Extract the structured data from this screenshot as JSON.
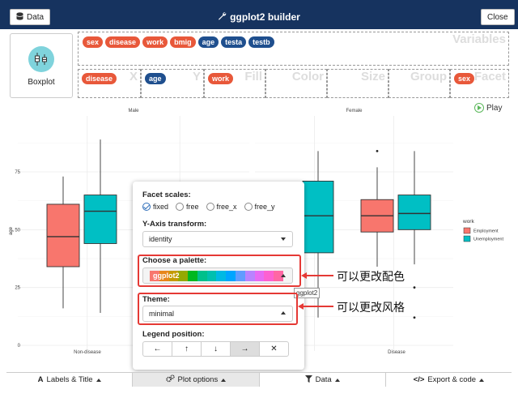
{
  "header": {
    "data_button": "Data",
    "title": "ggplot2 builder",
    "close_button": "Close",
    "bg_color": "#16335f"
  },
  "geom": {
    "label": "Boxplot",
    "icon": "boxplot-icon"
  },
  "dropzones": {
    "variables": {
      "label": "Variables",
      "chips": [
        {
          "label": "sex",
          "type": "categorical"
        },
        {
          "label": "disease",
          "type": "categorical"
        },
        {
          "label": "work",
          "type": "categorical"
        },
        {
          "label": "bmig",
          "type": "categorical"
        },
        {
          "label": "age",
          "type": "numeric"
        },
        {
          "label": "testa",
          "type": "numeric"
        },
        {
          "label": "testb",
          "type": "numeric"
        }
      ]
    },
    "x": {
      "label": "X",
      "chip": "disease"
    },
    "y": {
      "label": "Y",
      "chip": "age"
    },
    "fill": {
      "label": "Fill",
      "chip": "work"
    },
    "color": {
      "label": "Color"
    },
    "size": {
      "label": "Size"
    },
    "group": {
      "label": "Group"
    },
    "facet": {
      "label": "Facet",
      "chip": "sex"
    }
  },
  "play": {
    "label": "Play"
  },
  "chart_data": {
    "type": "bar",
    "subtype": "boxplot",
    "facets": [
      "Male",
      "Female"
    ],
    "ylabel": "age",
    "ylim": [
      0,
      100
    ],
    "yticks": [
      0,
      25,
      50,
      75
    ],
    "grid": true,
    "legend": {
      "title": "work",
      "position": "right",
      "entries": [
        {
          "name": "Employment",
          "color": "#f8766d"
        },
        {
          "name": "Unemployment",
          "color": "#00bfc4"
        }
      ]
    },
    "x_tick_labels": [
      "Non-disease",
      "Disease"
    ],
    "series": [
      {
        "name": "Male / Non-disease / Employment",
        "min": 16,
        "q1": 34,
        "median": 47,
        "q3": 61,
        "max": 73,
        "color": "#f8766d"
      },
      {
        "name": "Male / Non-disease / Unemployment",
        "min": 14,
        "q1": 44,
        "median": 58,
        "q3": 65,
        "max": 89,
        "color": "#00bfc4"
      },
      {
        "name": "Female / Non-disease / Unemployment",
        "min": 12,
        "q1": 40,
        "median": 56,
        "q3": 71,
        "max": 84,
        "color": "#00bfc4"
      },
      {
        "name": "Female / Disease / Employment",
        "min": 34,
        "q1": 49,
        "median": 56,
        "q3": 63,
        "max": 77,
        "outliers": [
          84
        ],
        "color": "#f8766d"
      },
      {
        "name": "Female / Disease / Unemployment",
        "min": 35,
        "q1": 50,
        "median": 57,
        "q3": 65,
        "max": 84,
        "outliers": [
          25,
          12
        ],
        "color": "#00bfc4"
      }
    ]
  },
  "panel": {
    "facet_scales_label": "Facet scales:",
    "facet_options": [
      {
        "label": "fixed",
        "selected": true
      },
      {
        "label": "free",
        "selected": false
      },
      {
        "label": "free_x",
        "selected": false
      },
      {
        "label": "free_y",
        "selected": false
      }
    ],
    "y_transform_label": "Y-Axis transform:",
    "y_transform_value": "identity",
    "palette_label": "Choose a palette:",
    "palette_value": "ggplot2",
    "palette_colors": [
      "#f8766d",
      "#e7861b",
      "#c49a00",
      "#95a900",
      "#00b81f",
      "#00c08b",
      "#00c0af",
      "#00b9e3",
      "#00a5ff",
      "#619cff",
      "#b983ff",
      "#e76bf3",
      "#fd61d1",
      "#ff67a4"
    ],
    "palette_tooltip": "ggplot2",
    "theme_label": "Theme:",
    "theme_value": "minimal",
    "legend_pos_label": "Legend position:",
    "legend_positions": [
      {
        "label": "←",
        "name": "left",
        "active": false
      },
      {
        "label": "↑",
        "name": "top",
        "active": false
      },
      {
        "label": "↓",
        "name": "bottom",
        "active": false
      },
      {
        "label": "→",
        "name": "right",
        "active": true
      },
      {
        "label": "✕",
        "name": "none",
        "active": false
      }
    ]
  },
  "annotations": {
    "palette_note": "可以更改配色",
    "theme_note": "可以更改风格",
    "box_color": "#e53935"
  },
  "tabs": [
    {
      "label": "Labels & Title",
      "icon": "font-icon",
      "active": false
    },
    {
      "label": "Plot options",
      "icon": "gears-icon",
      "active": true
    },
    {
      "label": "Data",
      "icon": "filter-icon",
      "active": false
    },
    {
      "label": "Export & code",
      "icon": "code-icon",
      "active": false
    }
  ]
}
